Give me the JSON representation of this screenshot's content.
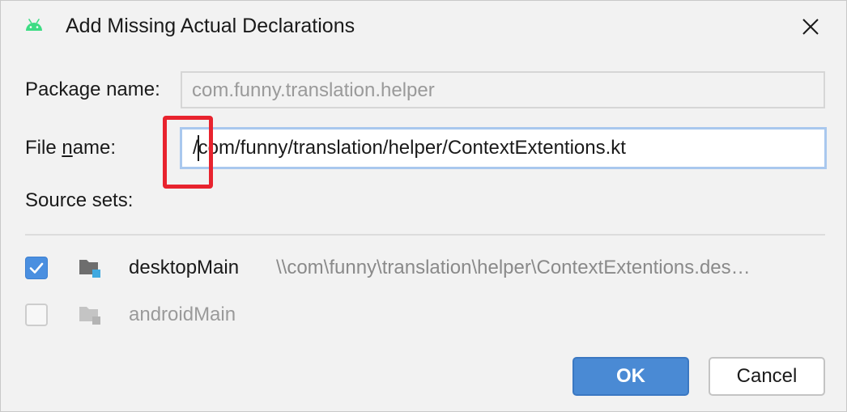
{
  "dialog": {
    "title": "Add Missing Actual Declarations",
    "app_icon": "android-icon",
    "close_icon": "close-icon"
  },
  "form": {
    "package_label_pre": "Packa",
    "package_label_mnemonic": "g",
    "package_label_post": "e name:",
    "package_value": "com.funny.translation.helper",
    "file_label_pre": "File ",
    "file_label_mnemonic": "n",
    "file_label_post": "ame:",
    "file_value": "/com/funny/translation/helper/ContextExtentions.kt",
    "source_sets_label": "Source sets:"
  },
  "source_sets": [
    {
      "name": "desktopMain",
      "path": "\\\\com\\funny\\translation\\helper\\ContextExtentions.des…",
      "checked": true,
      "enabled": true
    },
    {
      "name": "androidMain",
      "path": "",
      "checked": false,
      "enabled": false
    }
  ],
  "buttons": {
    "ok_label": "OK",
    "cancel_label": "Cancel"
  },
  "colors": {
    "accent": "#4a8ad4",
    "annotation": "#e8232e",
    "android_green": "#3ddc84",
    "disabled_text": "#9a9a9a"
  }
}
